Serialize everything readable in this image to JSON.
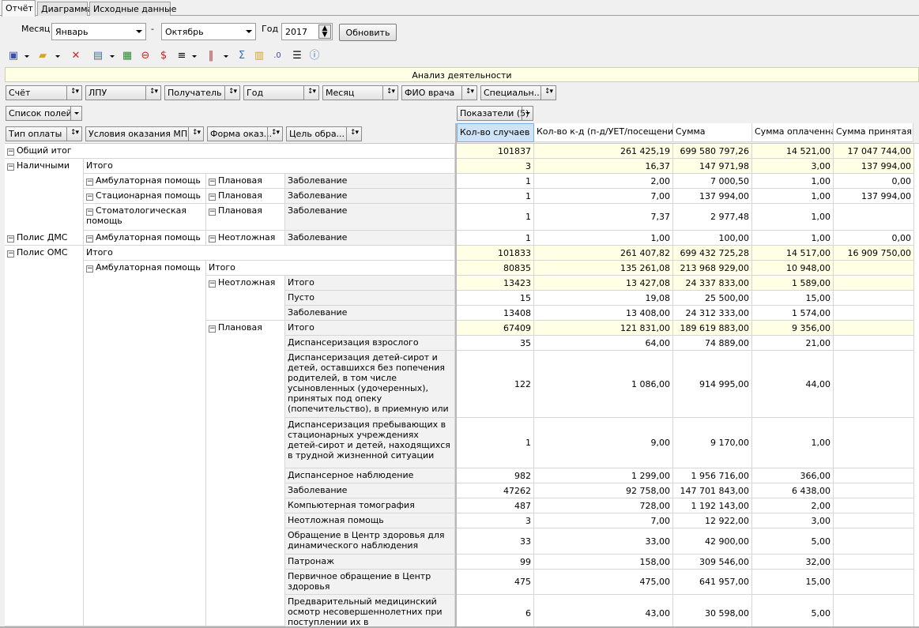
{
  "tabs": [
    {
      "label": "Отчёт",
      "active": true
    },
    {
      "label": "Диаграмма",
      "active": false
    },
    {
      "label": "Исходные данные",
      "active": false
    }
  ],
  "params": {
    "month_label": "Месяц",
    "month_from": "Январь",
    "dash": "-",
    "month_to": "Октябрь",
    "year_label": "Год",
    "year": "2017",
    "refresh_button": "Обновить"
  },
  "toolbar": {
    "icons": [
      "save-icon",
      "open-folder-icon",
      "delete-icon",
      "export-icon",
      "refresh-layout-icon",
      "strike-icon",
      "currency-icon",
      "columns-icon",
      "bars-icon",
      "formula-icon",
      "chart-icon",
      "decimal-icon",
      "text-icon",
      "info-icon"
    ]
  },
  "report_title": "Анализ деятельности",
  "filter_fields": [
    {
      "label": "Счёт"
    },
    {
      "label": "ЛПУ"
    },
    {
      "label": "Получатель"
    },
    {
      "label": "Год"
    },
    {
      "label": "Месяц"
    },
    {
      "label": "ФИО врача"
    },
    {
      "label": "Специальн..."
    }
  ],
  "field_list_button": "Список полей",
  "measures_button": "Показатели (5)",
  "row_fields": [
    {
      "label": "Тип оплаты"
    },
    {
      "label": "Условия оказания МП"
    },
    {
      "label": "Форма оказ..."
    },
    {
      "label": "Цель обра..."
    }
  ],
  "columns": [
    "Кол-во случаев",
    "Кол-во к-д (п-д/УЕТ/посещений)",
    "Сумма",
    "Сумма оплаченная",
    "Сумма принятая"
  ],
  "rows": [
    {
      "values": [
        "101837",
        "261 425,19",
        "699 580 797,26",
        "14 521,00",
        "17 047 744,00"
      ],
      "total": true
    },
    {
      "values": [
        "3",
        "16,37",
        "147 971,98",
        "3,00",
        "137 994,00"
      ],
      "total": true
    },
    {
      "values": [
        "1",
        "2,00",
        "7 000,50",
        "1,00",
        "0,00"
      ],
      "total": false
    },
    {
      "values": [
        "1",
        "7,00",
        "137 994,00",
        "1,00",
        "137 994,00"
      ],
      "total": false
    },
    {
      "values": [
        "1",
        "7,37",
        "2 977,48",
        "1,00",
        ""
      ],
      "total": false
    },
    {
      "values": [
        "1",
        "1,00",
        "100,00",
        "1,00",
        "0,00"
      ],
      "total": false
    },
    {
      "values": [
        "101833",
        "261 407,82",
        "699 432 725,28",
        "14 517,00",
        "16 909 750,00"
      ],
      "total": true
    },
    {
      "values": [
        "80835",
        "135 261,08",
        "213 968 929,00",
        "10 948,00",
        ""
      ],
      "total": true
    },
    {
      "values": [
        "13423",
        "13 427,08",
        "24 337 833,00",
        "1 589,00",
        ""
      ],
      "total": true
    },
    {
      "values": [
        "15",
        "19,08",
        "25 500,00",
        "15,00",
        ""
      ],
      "total": false
    },
    {
      "values": [
        "13408",
        "13 408,00",
        "24 312 333,00",
        "1 574,00",
        ""
      ],
      "total": false
    },
    {
      "values": [
        "67409",
        "121 831,00",
        "189 619 883,00",
        "9 356,00",
        ""
      ],
      "total": true
    },
    {
      "values": [
        "35",
        "64,00",
        "74 889,00",
        "21,00",
        ""
      ],
      "total": false
    },
    {
      "values": [
        "122",
        "1 086,00",
        "914 995,00",
        "44,00",
        ""
      ],
      "total": false
    },
    {
      "values": [
        "1",
        "9,00",
        "9 170,00",
        "1,00",
        ""
      ],
      "total": false
    },
    {
      "values": [
        "982",
        "1 299,00",
        "1 956 716,00",
        "366,00",
        ""
      ],
      "total": false
    },
    {
      "values": [
        "47262",
        "92 758,00",
        "147 701 843,00",
        "6 438,00",
        ""
      ],
      "total": false
    },
    {
      "values": [
        "487",
        "728,00",
        "1 192 143,00",
        "2,00",
        ""
      ],
      "total": false
    },
    {
      "values": [
        "3",
        "7,00",
        "12 922,00",
        "3,00",
        ""
      ],
      "total": false
    },
    {
      "values": [
        "33",
        "33,00",
        "42 900,00",
        "5,00",
        ""
      ],
      "total": false
    },
    {
      "values": [
        "99",
        "158,00",
        "309 546,00",
        "32,00",
        ""
      ],
      "total": false
    },
    {
      "values": [
        "475",
        "475,00",
        "641 957,00",
        "15,00",
        ""
      ],
      "total": false
    },
    {
      "values": [
        "6",
        "43,00",
        "30 598,00",
        "5,00",
        ""
      ],
      "total": false
    }
  ],
  "row_headers": [
    {
      "text": "Общий итог",
      "pm": true,
      "level": 0
    },
    {
      "text": "Наличными",
      "pm": true,
      "level": 0
    },
    {
      "text": "Итого",
      "pm": false,
      "level": 1
    },
    {
      "text": "Амбулаторная помощь",
      "pm": true,
      "level": 1
    },
    {
      "text": "Плановая",
      "pm": true,
      "level": 2
    },
    {
      "text": "Заболевание",
      "pm": false,
      "level": 3
    },
    {
      "text": "Стационарная помощь",
      "pm": true,
      "level": 1
    },
    {
      "text": "Плановая",
      "pm": true,
      "level": 2
    },
    {
      "text": "Заболевание",
      "pm": false,
      "level": 3
    },
    {
      "text": "Стоматологическая помощь",
      "pm": true,
      "level": 1
    },
    {
      "text": "Плановая",
      "pm": true,
      "level": 2
    },
    {
      "text": "Заболевание",
      "pm": false,
      "level": 3
    },
    {
      "text": "Полис ДМС",
      "pm": true,
      "level": 0
    },
    {
      "text": "Амбулаторная помощь",
      "pm": true,
      "level": 1
    },
    {
      "text": "Неотложная",
      "pm": true,
      "level": 2
    },
    {
      "text": "Заболевание",
      "pm": false,
      "level": 3
    },
    {
      "text": "Полис ОМС",
      "pm": true,
      "level": 0
    },
    {
      "text": "Итого",
      "pm": false,
      "level": 1
    },
    {
      "text": "Амбулаторная помощь",
      "pm": true,
      "level": 1
    },
    {
      "text": "Итого",
      "pm": false,
      "level": 2
    },
    {
      "text": "Неотложная",
      "pm": true,
      "level": 2
    },
    {
      "text": "Итого",
      "pm": false,
      "level": 3
    },
    {
      "text": "Пусто",
      "pm": false,
      "level": 3
    },
    {
      "text": "Заболевание",
      "pm": false,
      "level": 3
    },
    {
      "text": "Плановая",
      "pm": true,
      "level": 2
    },
    {
      "text": "Итого",
      "pm": false,
      "level": 3
    },
    {
      "text": "Диспансеризация взрослого населения",
      "pm": false,
      "level": 3
    },
    {
      "text": "Диспансеризация детей-сирот и детей, оставшихся без попечения родителей, в том числе усыновленных (удочеренных), принятых под опеку (попечительство), в приемную или патронатную семью",
      "pm": false,
      "level": 3
    },
    {
      "text": "Диспансеризация пребывающих в стационарных учреждениях детей-сирот и детей, находящихся в трудной жизненной ситуации",
      "pm": false,
      "level": 3
    },
    {
      "text": "Диспансерное наблюдение",
      "pm": false,
      "level": 3
    },
    {
      "text": "Заболевание",
      "pm": false,
      "level": 3
    },
    {
      "text": "Компьютерная томография",
      "pm": false,
      "level": 3
    },
    {
      "text": "Неотложная помощь",
      "pm": false,
      "level": 3
    },
    {
      "text": "Обращение в Центр здоровья для динамического наблюдения",
      "pm": false,
      "level": 3
    },
    {
      "text": "Патронаж",
      "pm": false,
      "level": 3
    },
    {
      "text": "Первичное обращение в Центр здоровья",
      "pm": false,
      "level": 3
    },
    {
      "text": "Предварительный медицинский осмотр несовершеннолетних при поступлении их в образовательные учреждения",
      "pm": false,
      "level": 3
    }
  ]
}
